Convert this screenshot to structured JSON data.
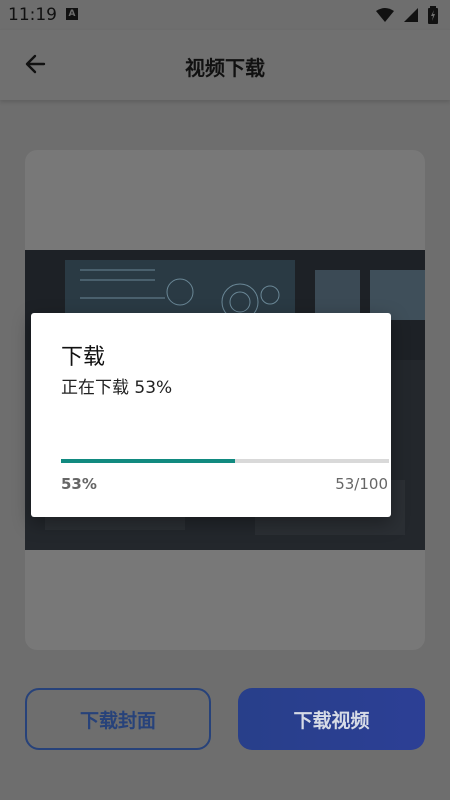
{
  "statusbar": {
    "time": "11:19",
    "notification_letter": "A"
  },
  "appbar": {
    "title": "视频下载"
  },
  "actions": {
    "download_cover": "下载封面",
    "download_video": "下载视频"
  },
  "dialog": {
    "title": "下载",
    "message": "正在下载 53%",
    "percent_label": "53%",
    "count_label": "53/100",
    "progress": 0.53
  },
  "colors": {
    "accent": "#118a80",
    "primary": "#283f8a",
    "outline": "#27427a"
  }
}
